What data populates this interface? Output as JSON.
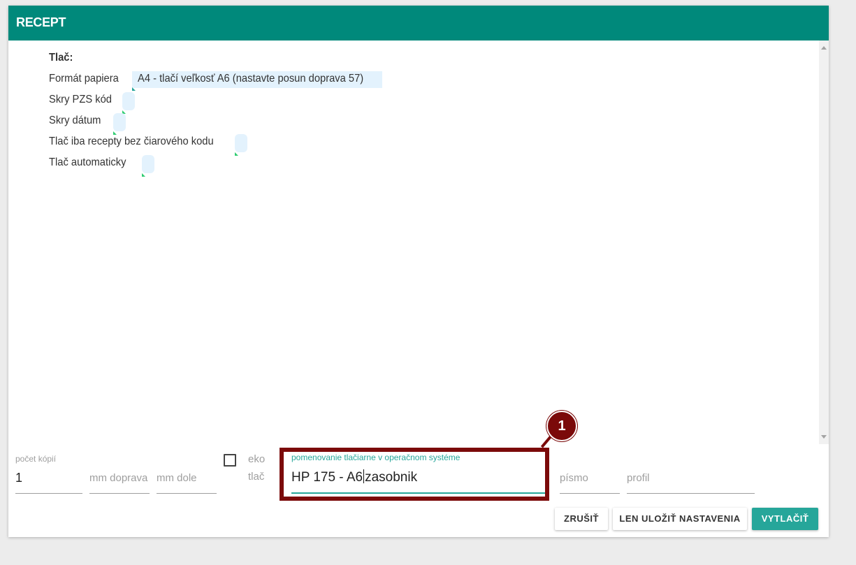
{
  "header": {
    "title": "RECEPT"
  },
  "print_section": {
    "title": "Tlač:",
    "paper_format_label": "Formát papiera",
    "paper_format_value": "A4 - tlačí veľkosť A6 (nastavte posun doprava 57)",
    "hide_pzs_label": "Skry PZS kód",
    "hide_date_label": "Skry dátum",
    "barcode_only_label": "Tlač iba recepty bez čiarového kodu",
    "auto_print_label": "Tlač automaticky"
  },
  "footer": {
    "copies_label": "počet kópií",
    "copies_value": "1",
    "mm_right_placeholder": "mm doprava",
    "mm_bottom_placeholder": "mm dole",
    "eco_label_line1": "eko",
    "eco_label_line2": "tlač",
    "printer_label": "pomenovanie tlačiarne v operačnom systéme",
    "printer_value_before_caret": "HP 175 - A6",
    "printer_value_after_caret": "zasobnik",
    "font_placeholder": "písmo",
    "profile_placeholder": "profil"
  },
  "buttons": {
    "cancel": "ZRUŠIŤ",
    "save_settings": "LEN ULOŽIŤ NASTAVENIA",
    "print": "VYTLAČIŤ"
  },
  "annotation": {
    "callout_number": "1"
  },
  "colors": {
    "accent": "#00897b",
    "accent_light": "#26a69a",
    "highlight": "#7b0a0a",
    "field_bg": "#e3f2fd"
  }
}
